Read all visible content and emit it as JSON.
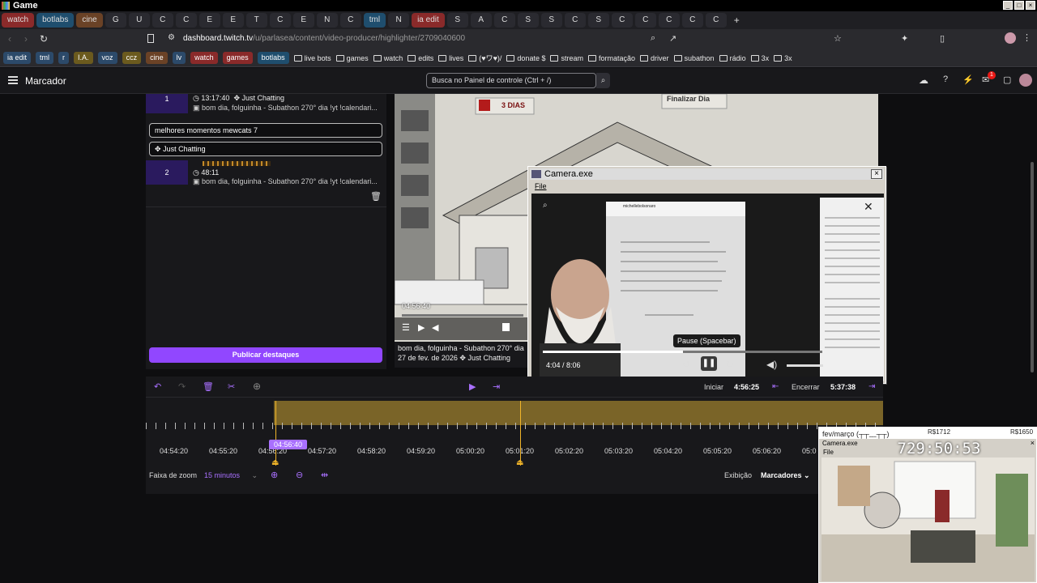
{
  "window": {
    "title": "Game"
  },
  "tabs": [
    {
      "label": "watch",
      "color": "red"
    },
    {
      "label": "botlabs",
      "color": "blue"
    },
    {
      "label": "cine",
      "color": "brown"
    },
    {
      "label": "G",
      "color": ""
    },
    {
      "label": "U",
      "color": ""
    },
    {
      "label": "C",
      "color": ""
    },
    {
      "label": "C",
      "color": ""
    },
    {
      "label": "E",
      "color": ""
    },
    {
      "label": "E",
      "color": ""
    },
    {
      "label": "T",
      "color": ""
    },
    {
      "label": "C",
      "color": ""
    },
    {
      "label": "E",
      "color": ""
    },
    {
      "label": "N",
      "color": ""
    },
    {
      "label": "C",
      "color": ""
    },
    {
      "label": "tml",
      "color": "blue"
    },
    {
      "label": "N",
      "color": ""
    },
    {
      "label": "ia edit",
      "color": "red"
    },
    {
      "label": "S",
      "color": ""
    },
    {
      "label": "A",
      "color": ""
    },
    {
      "label": "C",
      "color": ""
    },
    {
      "label": "S",
      "color": ""
    },
    {
      "label": "S",
      "color": ""
    },
    {
      "label": "C",
      "color": ""
    },
    {
      "label": "S",
      "color": ""
    },
    {
      "label": "C",
      "color": ""
    },
    {
      "label": "C",
      "color": ""
    },
    {
      "label": "C",
      "color": ""
    },
    {
      "label": "C",
      "color": ""
    },
    {
      "label": "C",
      "color": ""
    }
  ],
  "addressbar": {
    "url_host": "dashboard.twitch.tv",
    "url_path": "/u/parlasea/content/video-producer/highlighter/2709040600"
  },
  "bookmarks": [
    {
      "label": "ia edit",
      "kind": "chip",
      "color": "#2c4a6a"
    },
    {
      "label": "tml",
      "kind": "chip",
      "color": "#2c4a6a"
    },
    {
      "label": "r",
      "kind": "chip",
      "color": "#2c4a6a"
    },
    {
      "label": "I.A.",
      "kind": "chip",
      "color": "#6b5a1e"
    },
    {
      "label": "voz",
      "kind": "chip",
      "color": "#2c4a6a"
    },
    {
      "label": "ccz",
      "kind": "chip",
      "color": "#6b5a1e"
    },
    {
      "label": "cine",
      "kind": "chip",
      "color": "#6b4226"
    },
    {
      "label": "lv",
      "kind": "chip",
      "color": "#2c4a6a"
    },
    {
      "label": "watch",
      "kind": "chip",
      "color": "#8a2a2a"
    },
    {
      "label": "games",
      "kind": "chip",
      "color": "#8a2a2a"
    },
    {
      "label": "botlabs",
      "kind": "chip",
      "color": "#1f4e6e"
    },
    {
      "label": "live bots",
      "kind": "folder"
    },
    {
      "label": "games",
      "kind": "folder"
    },
    {
      "label": "watch",
      "kind": "folder"
    },
    {
      "label": "edits",
      "kind": "folder"
    },
    {
      "label": "lives",
      "kind": "folder"
    },
    {
      "label": "(♥ワ♥)/",
      "kind": "folder"
    },
    {
      "label": "donate $",
      "kind": "folder"
    },
    {
      "label": "stream",
      "kind": "folder"
    },
    {
      "label": "formatação",
      "kind": "folder"
    },
    {
      "label": "driver",
      "kind": "folder"
    },
    {
      "label": "subathon",
      "kind": "folder"
    },
    {
      "label": "rádio",
      "kind": "folder"
    },
    {
      "label": "3x",
      "kind": "folder"
    },
    {
      "label": "3x",
      "kind": "folder"
    }
  ],
  "header": {
    "title": "Marcador",
    "search_placeholder": "Busca no Painel de controle (Ctrl + /)",
    "notif_count": "1"
  },
  "segments": [
    {
      "num": "1",
      "time": "13:17:40",
      "category": "Just Chatting",
      "desc": "bom dia, folguinha - Subathon 270° dia !yt !calendari..."
    },
    {
      "num": "2",
      "time": "48:11",
      "category": "",
      "desc": "bom dia, folguinha - Subathon 270° dia !yt !calendari..."
    }
  ],
  "highlight": {
    "title_value": "melhores momentos mewcats 7",
    "category_value": "Just Chatting"
  },
  "publish_label": "Publicar destaques",
  "preview": {
    "days_label": "3 DIAS",
    "finalize_label": "Finalizar Dia",
    "timestamp": "04:56:40",
    "info_title": "bom dia, folguinha - Subathon 270° dia",
    "info_date": "27 de fev. de 2026",
    "info_category": "Just Chatting"
  },
  "camera": {
    "title": "Camera.exe",
    "menu_file": "File",
    "tooltip": "Pause (Spacebar)",
    "time": "4:04 / 8:06",
    "ig_user": "michellebolsonaro",
    "progress_fraction": 0.5
  },
  "timeline": {
    "start_label": "Iniciar",
    "start_time": "4:56:25",
    "end_label": "Encerrar",
    "end_time": "5:37:38",
    "playhead_label": "04:56:40",
    "ticks": [
      "04:54:20",
      "04:55:20",
      "04:56:20",
      "04:57:20",
      "04:58:20",
      "04:59:20",
      "05:00:20",
      "05:01:20",
      "05:02:20",
      "05:03:20",
      "05:04:20",
      "05:05:20",
      "05:06:20",
      "05:0"
    ],
    "zoom_label": "Faixa de zoom",
    "zoom_value": "15 minutos",
    "view_label": "Exibição",
    "view_value": "Marcadores"
  },
  "camstrip": {
    "date_label": "fev/março (┬┬﹏┬┬)",
    "val1": "R$1712",
    "val2": "R$1650",
    "app_title": "Camera.exe",
    "menu_file": "File",
    "counter": "729:50:53"
  },
  "colors": {
    "accent": "#9147ff",
    "timeline_clip": "#7a6428",
    "marker": "#f0b429"
  }
}
